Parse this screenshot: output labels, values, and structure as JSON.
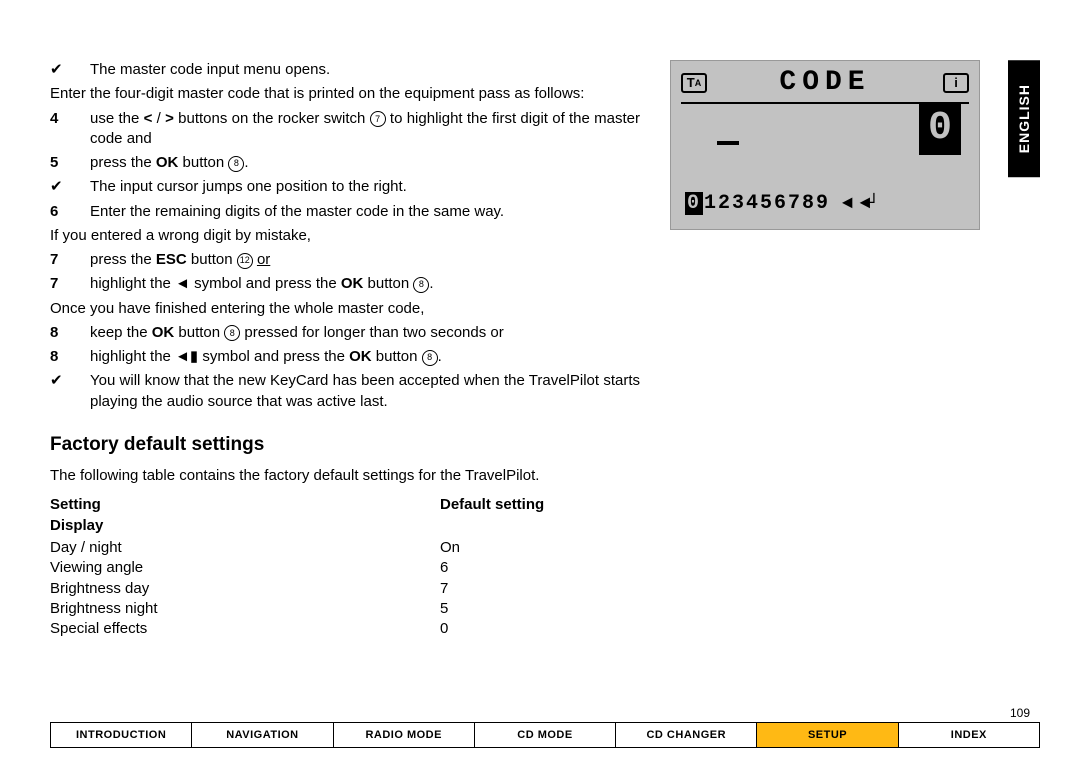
{
  "language_tab": "ENGLISH",
  "page_number": "109",
  "instructions": {
    "check1": "The master code input menu opens.",
    "intro": "Enter the four-digit master code that is printed on the equipment pass as follows:",
    "step4_a": "use the ",
    "step4_b": " buttons on the rocker switch ",
    "step4_c": " to highlight the first digit of the master code and",
    "step5_a": "press the ",
    "step5_b": " button ",
    "step5_c": ".",
    "check2": "The input cursor jumps one position to the right.",
    "step6": "Enter the remaining digits of the master code in the same way.",
    "wrong": "If you entered a wrong digit by mistake,",
    "step7a_a": "press the ",
    "step7a_b": " button ",
    "step7a_c": " or",
    "step7b_a": "highlight the ",
    "step7b_b": " symbol and press the ",
    "step7b_c": " button ",
    "step7b_d": ".",
    "finished": "Once you have finished entering the whole master code,",
    "step8a_a": "keep the ",
    "step8a_b": " button ",
    "step8a_c": " pressed for longer than two seconds or",
    "step8b_a": "highlight the ",
    "step8b_b": " symbol and press the ",
    "step8b_c": " button ",
    "step8b_d": ".",
    "check3": "You will know that the new KeyCard has been accepted when the TravelPilot starts playing the audio source that was active last.",
    "bold_ok": "OK",
    "bold_esc": "ESC",
    "num7": "7",
    "num8": "8",
    "num12": "12"
  },
  "section_heading": "Factory default settings",
  "section_intro": "The following table contains the factory default settings for the TravelPilot.",
  "table": {
    "header_setting": "Setting",
    "header_default": "Default setting",
    "group": "Display",
    "rows": [
      {
        "name": "Day / night",
        "value": "On"
      },
      {
        "name": "Viewing angle",
        "value": "6"
      },
      {
        "name": "Brightness day",
        "value": "7"
      },
      {
        "name": "Brightness night",
        "value": "5"
      },
      {
        "name": "Special effects",
        "value": "0"
      }
    ]
  },
  "nav": {
    "items": [
      "INTRODUCTION",
      "NAVIGATION",
      "RADIO MODE",
      "CD MODE",
      "CD CHANGER",
      "SETUP",
      "INDEX"
    ],
    "active": "SETUP"
  },
  "lcd": {
    "ta": "TA",
    "title": "CODE",
    "info": "i",
    "big": "0",
    "first_digit": "0",
    "rest_digits": "123456789",
    "arrows": "◄ ◄┘"
  }
}
